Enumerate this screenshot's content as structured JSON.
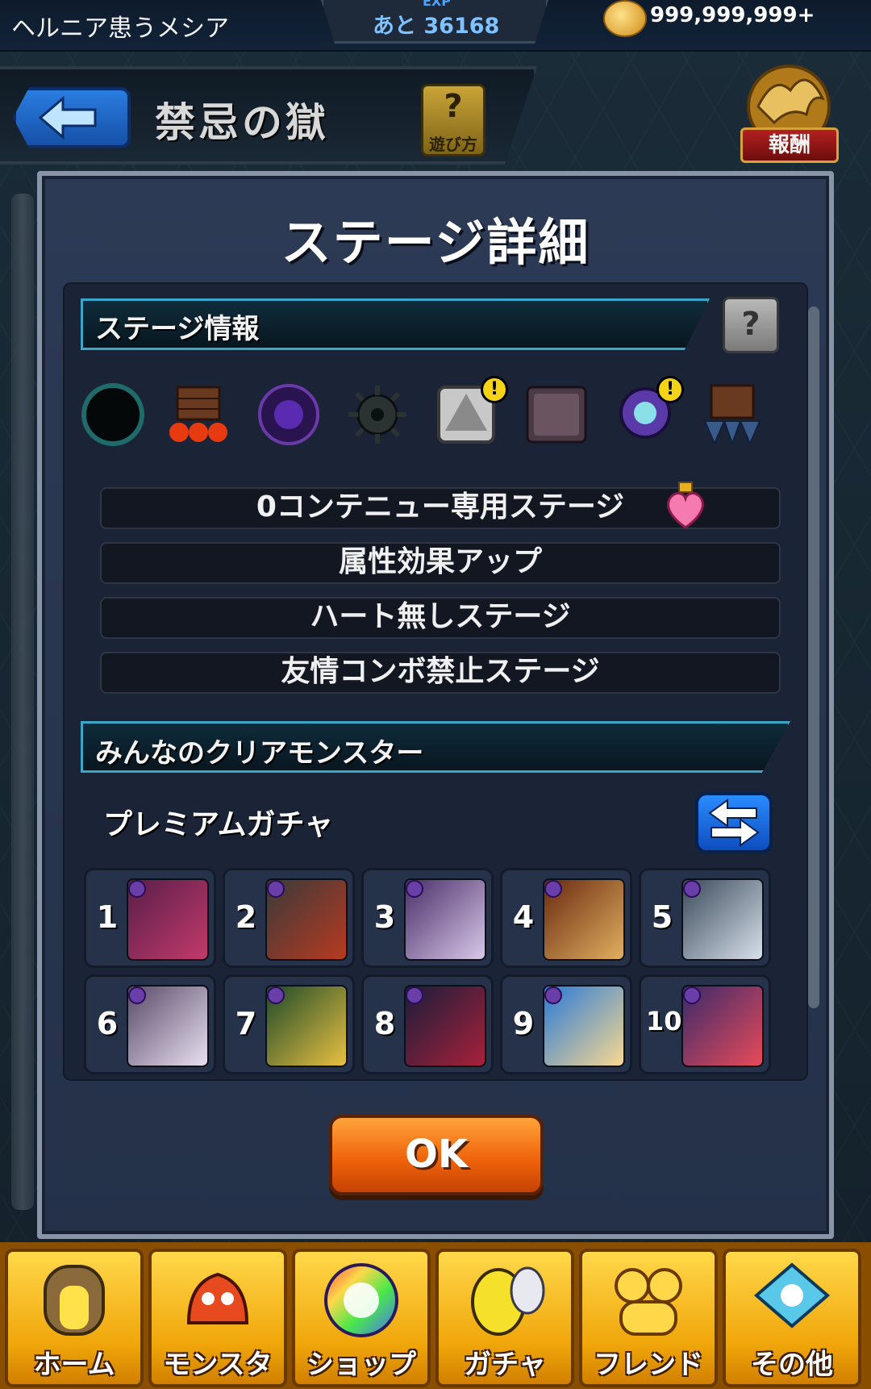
{
  "status": {
    "player_name": "ヘルニア患うメシア",
    "exp_label": "EXP",
    "exp_remaining": "あと 36168",
    "coins": "999,999,999+"
  },
  "header": {
    "title": "禁忌の獄",
    "howto_q": "?",
    "howto_label": "遊び方",
    "reward_label": "報酬"
  },
  "modal": {
    "title": "ステージ詳細",
    "stage_info_header": "ステージ情報",
    "help_label": "?",
    "gimmicks": [
      {
        "icon": "black-hole-icon",
        "warning": false
      },
      {
        "icon": "damage-wall-icon",
        "warning": false
      },
      {
        "icon": "warp-icon",
        "warning": false
      },
      {
        "icon": "mine-icon",
        "warning": false
      },
      {
        "icon": "block-icon",
        "warning": true
      },
      {
        "icon": "panel-icon",
        "warning": false
      },
      {
        "icon": "shield-icon",
        "warning": true
      },
      {
        "icon": "spike-wall-icon",
        "warning": false
      }
    ],
    "warning_mark": "!",
    "conditions": [
      "0コンテニュー専用ステージ",
      "属性効果アップ",
      "ハート無しステージ",
      "友情コンボ禁止ステージ"
    ],
    "clear_header": "みんなのクリアモンスター",
    "gacha_label": "プレミアムガチャ",
    "monsters": [
      {
        "rank": "1",
        "colors": [
          "#5a1e4a",
          "#c23a6a"
        ]
      },
      {
        "rank": "2",
        "colors": [
          "#3a3a3a",
          "#b83a20"
        ]
      },
      {
        "rank": "3",
        "colors": [
          "#4a2e6a",
          "#d8c8e8"
        ]
      },
      {
        "rank": "4",
        "colors": [
          "#6a2a10",
          "#e0b060"
        ]
      },
      {
        "rank": "5",
        "colors": [
          "#3a4a5a",
          "#d8e0ec"
        ]
      },
      {
        "rank": "6",
        "colors": [
          "#5a4a6a",
          "#e8e0f0"
        ]
      },
      {
        "rank": "7",
        "colors": [
          "#1e4a2a",
          "#e8c040"
        ]
      },
      {
        "rank": "8",
        "colors": [
          "#1a1e3a",
          "#a8203a"
        ]
      },
      {
        "rank": "9",
        "colors": [
          "#2a7ad8",
          "#f8d890"
        ]
      },
      {
        "rank": "10",
        "colors": [
          "#3a2a6a",
          "#e84a5a"
        ]
      }
    ],
    "ok_label": "OK"
  },
  "nav": [
    {
      "label": "ホーム",
      "icon": "home-gate-icon"
    },
    {
      "label": "モンスター",
      "icon": "dragon-icon"
    },
    {
      "label": "ショップ",
      "icon": "rainbow-orb-icon"
    },
    {
      "label": "ガチャ",
      "icon": "egg-icon"
    },
    {
      "label": "フレンド",
      "icon": "friends-icon"
    },
    {
      "label": "その他",
      "icon": "other-icon"
    }
  ],
  "colors": {
    "accent_blue": "#3aa6c8",
    "ok_orange": "#f0640a",
    "nav_yellow": "#ffd84a",
    "warning_yellow": "#f5d315"
  }
}
